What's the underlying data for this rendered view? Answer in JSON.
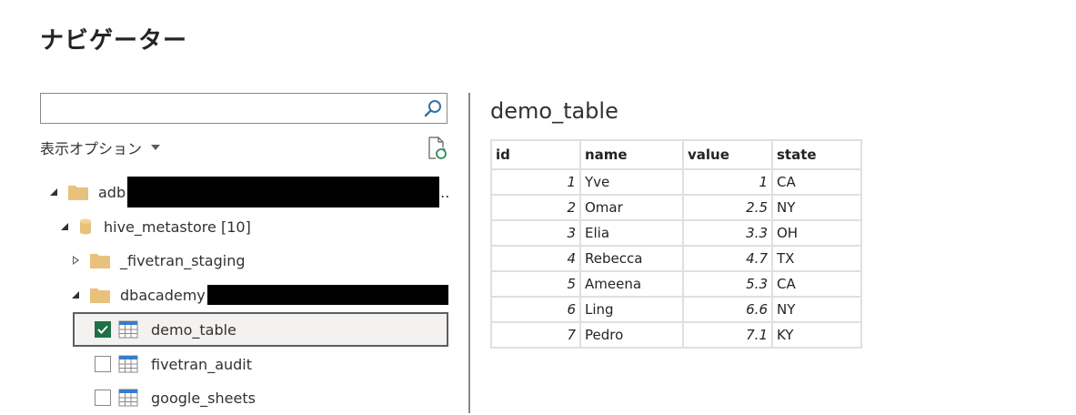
{
  "window": {
    "title": "ナビゲーター"
  },
  "search": {
    "value": "",
    "placeholder": ""
  },
  "display_options": {
    "label": "表示オプション"
  },
  "tree": {
    "root": {
      "label": "adb",
      "suffix": ".."
    },
    "catalog": {
      "label": "hive_metastore [10]"
    },
    "schemas": [
      {
        "label": "_fivetran_staging",
        "expanded": false
      },
      {
        "label": "dbacademy",
        "expanded": true
      }
    ],
    "tables": [
      {
        "label": "demo_table",
        "checked": true,
        "selected": true
      },
      {
        "label": "fivetran_audit",
        "checked": false,
        "selected": false
      },
      {
        "label": "google_sheets",
        "checked": false,
        "selected": false
      }
    ]
  },
  "preview": {
    "title": "demo_table",
    "columns": [
      "id",
      "name",
      "value",
      "state"
    ],
    "rows": [
      [
        "1",
        "Yve",
        "1",
        "CA"
      ],
      [
        "2",
        "Omar",
        "2.5",
        "NY"
      ],
      [
        "3",
        "Elia",
        "3.3",
        "OH"
      ],
      [
        "4",
        "Rebecca",
        "4.7",
        "TX"
      ],
      [
        "5",
        "Ameena",
        "5.3",
        "CA"
      ],
      [
        "6",
        "Ling",
        "6.6",
        "NY"
      ],
      [
        "7",
        "Pedro",
        "7.1",
        "KY"
      ]
    ]
  },
  "icons": {
    "search": "search-icon",
    "refresh": "refresh-icon",
    "folder": "folder-icon",
    "database": "database-icon",
    "table": "table-icon",
    "checkmark": "checkmark-icon"
  },
  "colors": {
    "checkbox_checked": "#1e7145",
    "folder": "#e8c17c",
    "table_icon": "#3a7bc8",
    "selected_row_bg": "#f3f2f1"
  }
}
